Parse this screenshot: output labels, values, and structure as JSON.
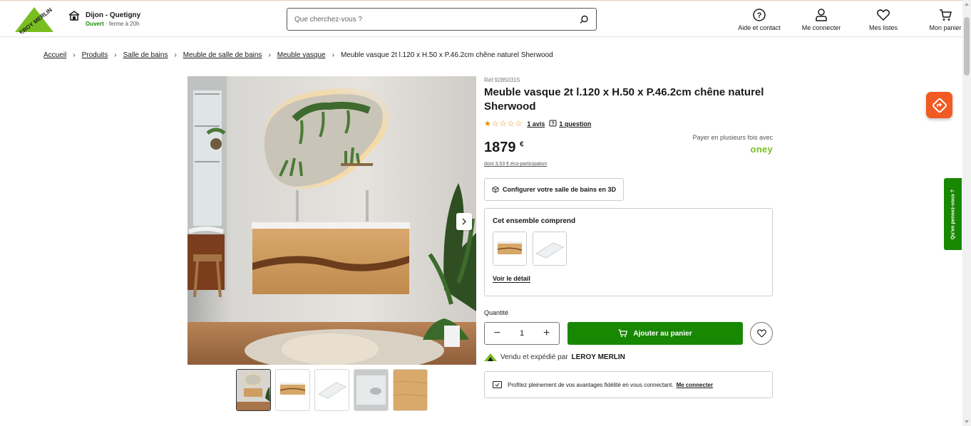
{
  "header": {
    "logo_text": "LEROY MERLIN",
    "store": {
      "name": "Dijon - Quetigny",
      "status": "Ouvert",
      "hours": "· ferme à 20h"
    },
    "search": {
      "placeholder": "Que cherchez-vous ?"
    },
    "actions": [
      {
        "label": "Aide et contact",
        "icon": "help-icon"
      },
      {
        "label": "Me connecter",
        "icon": "user-icon"
      },
      {
        "label": "Mes listes",
        "icon": "heart-icon"
      },
      {
        "label": "Mon panier",
        "icon": "cart-icon"
      }
    ]
  },
  "breadcrumb": {
    "items": [
      "Accueil",
      "Produits",
      "Salle de bains",
      "Meuble de salle de bains",
      "Meuble vasque"
    ],
    "current": "Meuble vasque 2t l.120 x H.50 x P.46.2cm chêne naturel Sherwood"
  },
  "product": {
    "ref": "Réf 92850315",
    "title": "Meuble vasque 2t l.120 x H.50 x P.46.2cm chêne naturel Sherwood",
    "stars": "★☆☆☆☆",
    "reviews": "1 avis",
    "questions": "1 question",
    "price": "1879",
    "currency": "€",
    "eco": "dont 3,53 € éco-participation",
    "pay_multi": "Payer en plusieurs fois avec",
    "oney": "oney",
    "configure": "Configurer votre salle de bains en 3D",
    "bundle_title": "Cet ensemble comprend",
    "bundle_detail": "Voir le détail",
    "qty_label": "Quantité",
    "qty_value": "1",
    "add_to_cart": "Ajouter au panier",
    "seller_prefix": "Vendu et expédié par",
    "seller_name": "LEROY MERLIN",
    "fidelity_text": "Profitez pleinement de vos avantages fidélité en vous connectant.",
    "fidelity_link": "Me connecter"
  },
  "feedback_tab": "Qu'en pensez-vous ?",
  "colors": {
    "brand_green": "#188803",
    "accent_orange": "#f15a22",
    "star_orange": "#e68a00"
  }
}
